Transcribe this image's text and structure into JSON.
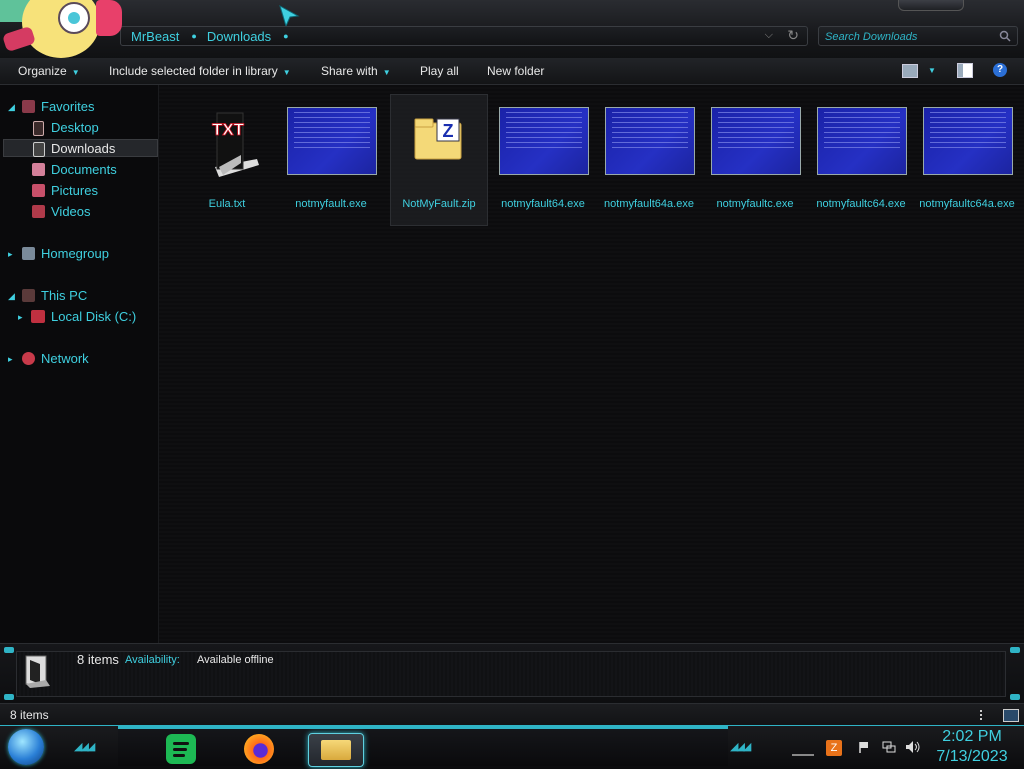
{
  "address": {
    "crumbs": [
      "MrBeast",
      "Downloads"
    ]
  },
  "search": {
    "placeholder": "Search Downloads"
  },
  "toolbar": {
    "organize": "Organize",
    "include_library": "Include selected folder in library",
    "share_with": "Share with",
    "play_all": "Play all",
    "new_folder": "New folder"
  },
  "nav": {
    "favorites": "Favorites",
    "desktop": "Desktop",
    "downloads": "Downloads",
    "documents": "Documents",
    "pictures": "Pictures",
    "videos": "Videos",
    "homegroup": "Homegroup",
    "this_pc": "This PC",
    "local_disk": "Local Disk (C:)",
    "network": "Network"
  },
  "files": [
    {
      "name": "Eula.txt",
      "type": "txt"
    },
    {
      "name": "notmyfault.exe",
      "type": "exe"
    },
    {
      "name": "NotMyFault.zip",
      "type": "zip"
    },
    {
      "name": "notmyfault64.exe",
      "type": "exe"
    },
    {
      "name": "notmyfault64a.exe",
      "type": "exe"
    },
    {
      "name": "notmyfaultc.exe",
      "type": "exe"
    },
    {
      "name": "notmyfaultc64.exe",
      "type": "exe"
    },
    {
      "name": "notmyfaultc64a.exe",
      "type": "exe"
    }
  ],
  "file_icon_text": {
    "txt": "TXT",
    "zip": "Z"
  },
  "details": {
    "count": "8 items",
    "availability_label": "Availability:",
    "availability_value": "Available offline"
  },
  "status": {
    "count": "8 items"
  },
  "clock": {
    "time": "2:02 PM",
    "date": "7/13/2023"
  },
  "colors": {
    "accent": "#3fd0e0",
    "background": "#0b0b0d"
  }
}
